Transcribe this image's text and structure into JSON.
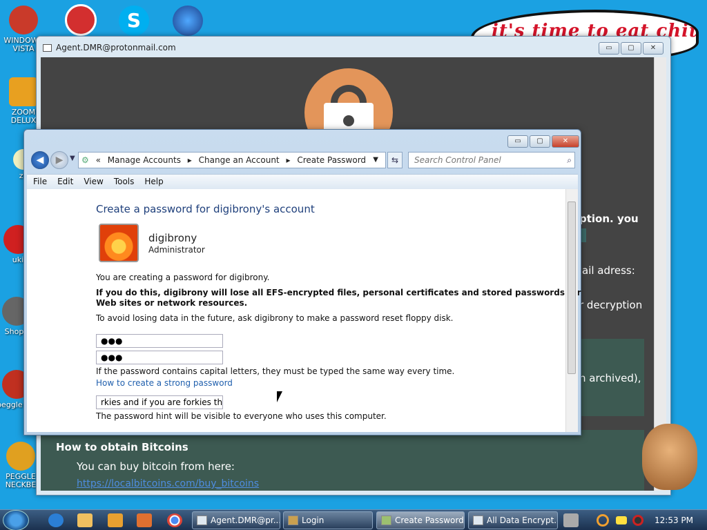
{
  "desktop": {
    "icons": [
      {
        "label": "WINDOWS VISTA",
        "color": "#c93a2a"
      },
      {
        "label": "ZOOM DELUX",
        "color": "#e8a020"
      },
      {
        "label": "zo",
        "color": "#f0f0c0"
      },
      {
        "label": "uki",
        "color": "#d02020"
      },
      {
        "label": "Shopp",
        "color": "#666"
      },
      {
        "label": "peggle hei",
        "color": "#c03020"
      },
      {
        "label": "PEGGLE NECKBE",
        "color": "#e0a020"
      }
    ],
    "bubble_text": "it's time to eat chit"
  },
  "ransom_window": {
    "title": "Agent.DMR@protonmail.com",
    "text1": "ption. you",
    "text2": "ail adress:",
    "text3": "r decryption",
    "text4": "n archived),",
    "btc_title": "How to obtain Bitcoins",
    "btc_sub": "You can buy bitcoin from here:",
    "btc_link": "https://localbitcoins.com/buy_bitcoins",
    "btn_min": "▭",
    "btn_max": "▢",
    "btn_close": "✕"
  },
  "explorer": {
    "breadcrumb": [
      "«",
      "Manage Accounts",
      "▸",
      "Change an Account",
      "▸",
      "Create Password"
    ],
    "search_placeholder": "Search Control Panel",
    "menu": [
      "File",
      "Edit",
      "View",
      "Tools",
      "Help"
    ],
    "heading": "Create a password for digibrony's account",
    "username": "digibrony",
    "role": "Administrator",
    "p1": "You are creating a password for digibrony.",
    "p2a": "If you do this, digibrony will lose all EFS-encrypted files, personal certificates and stored passwords for",
    "p2b": "Web sites or network resources.",
    "p3": "To avoid losing data in the future, ask digibrony to make a password reset floppy disk.",
    "password_value": "●●●",
    "confirm_value": "●●●",
    "p4": "If the password contains capital letters, they must be typed the same way every time.",
    "strong_link": "How to create a strong password",
    "hint_value": "rkies and if you are forkies then g",
    "p5": "The password hint will be visible to everyone who uses this computer.",
    "btn_min": "▭",
    "btn_max": "▢",
    "btn_close": "✕"
  },
  "taskbar": {
    "tasks": [
      "Agent.DMR@pr...",
      "Login",
      "Create Password",
      "All Data Encrypt..."
    ],
    "clock": "12:53 PM"
  }
}
